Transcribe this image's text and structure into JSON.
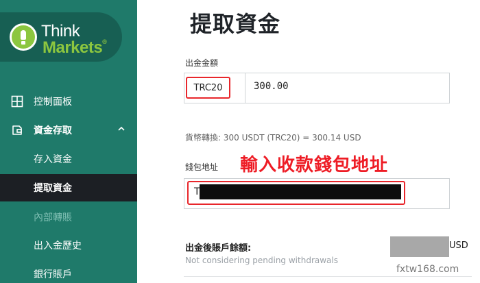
{
  "brand": {
    "think": "Think",
    "markets": "Markets",
    "reg": "®",
    "accent": "#8cc63f",
    "sidebar_bg": "#1f7a6a"
  },
  "sidebar": {
    "items": [
      {
        "label": "控制面板",
        "icon": "dashboard-grid-icon"
      },
      {
        "label": "資金存取",
        "icon": "wallet-icon",
        "expanded": true
      },
      {
        "label": "存入資金"
      },
      {
        "label": "提取資金",
        "active": true
      },
      {
        "label": "內部轉賬",
        "disabled": true
      },
      {
        "label": "出入金歷史"
      },
      {
        "label": "銀行賬戶"
      }
    ]
  },
  "main": {
    "title": "提取資金",
    "amount_label": "出金金額",
    "currency": "TRC20",
    "amount": "300.00",
    "conversion": "貨幣轉換: 300  USDT (TRC20) = 300.14  USD",
    "annotation": "輸入收款錢包地址",
    "wallet_label": "錢包地址",
    "wallet_prefix": "T",
    "balance_label": "出金後賬戶餘額:",
    "balance_note": "Not considering pending withdrawals",
    "balance_unit": "USD"
  },
  "watermark": "fxtw168.com"
}
